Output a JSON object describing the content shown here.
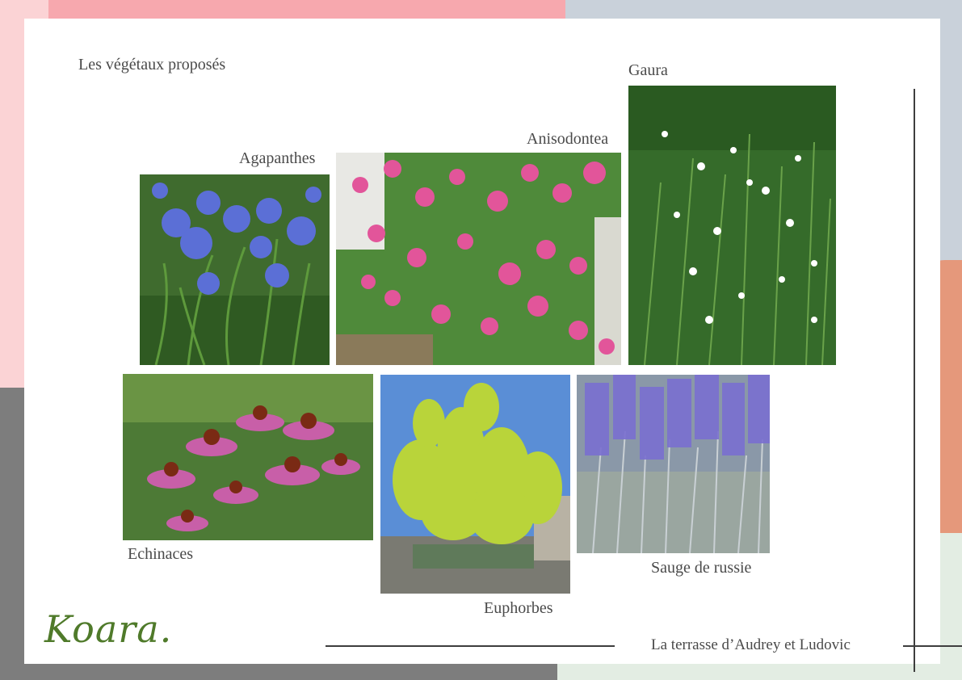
{
  "page": {
    "title": "Les végétaux proposés"
  },
  "plants": [
    {
      "id": "agapanthes",
      "label": "Agapanthes"
    },
    {
      "id": "anisodontea",
      "label": "Anisodontea"
    },
    {
      "id": "gaura",
      "label": "Gaura"
    },
    {
      "id": "echinaces",
      "label": "Echinaces"
    },
    {
      "id": "euphorbes",
      "label": "Euphorbes"
    },
    {
      "id": "sauge",
      "label": "Sauge de russie"
    }
  ],
  "footer": {
    "project": "La terrasse d’Audrey et Ludovic",
    "logo_text": "Koara."
  },
  "colors": {
    "pink_blob": "#f7a8ae",
    "dark_blob": "#7d7d7d",
    "orange_blob": "#e5987b",
    "mint_blob": "#e3ede3",
    "line": "#3e3e3e",
    "text": "#4a4a4a",
    "logo": "#4f7a2a"
  }
}
